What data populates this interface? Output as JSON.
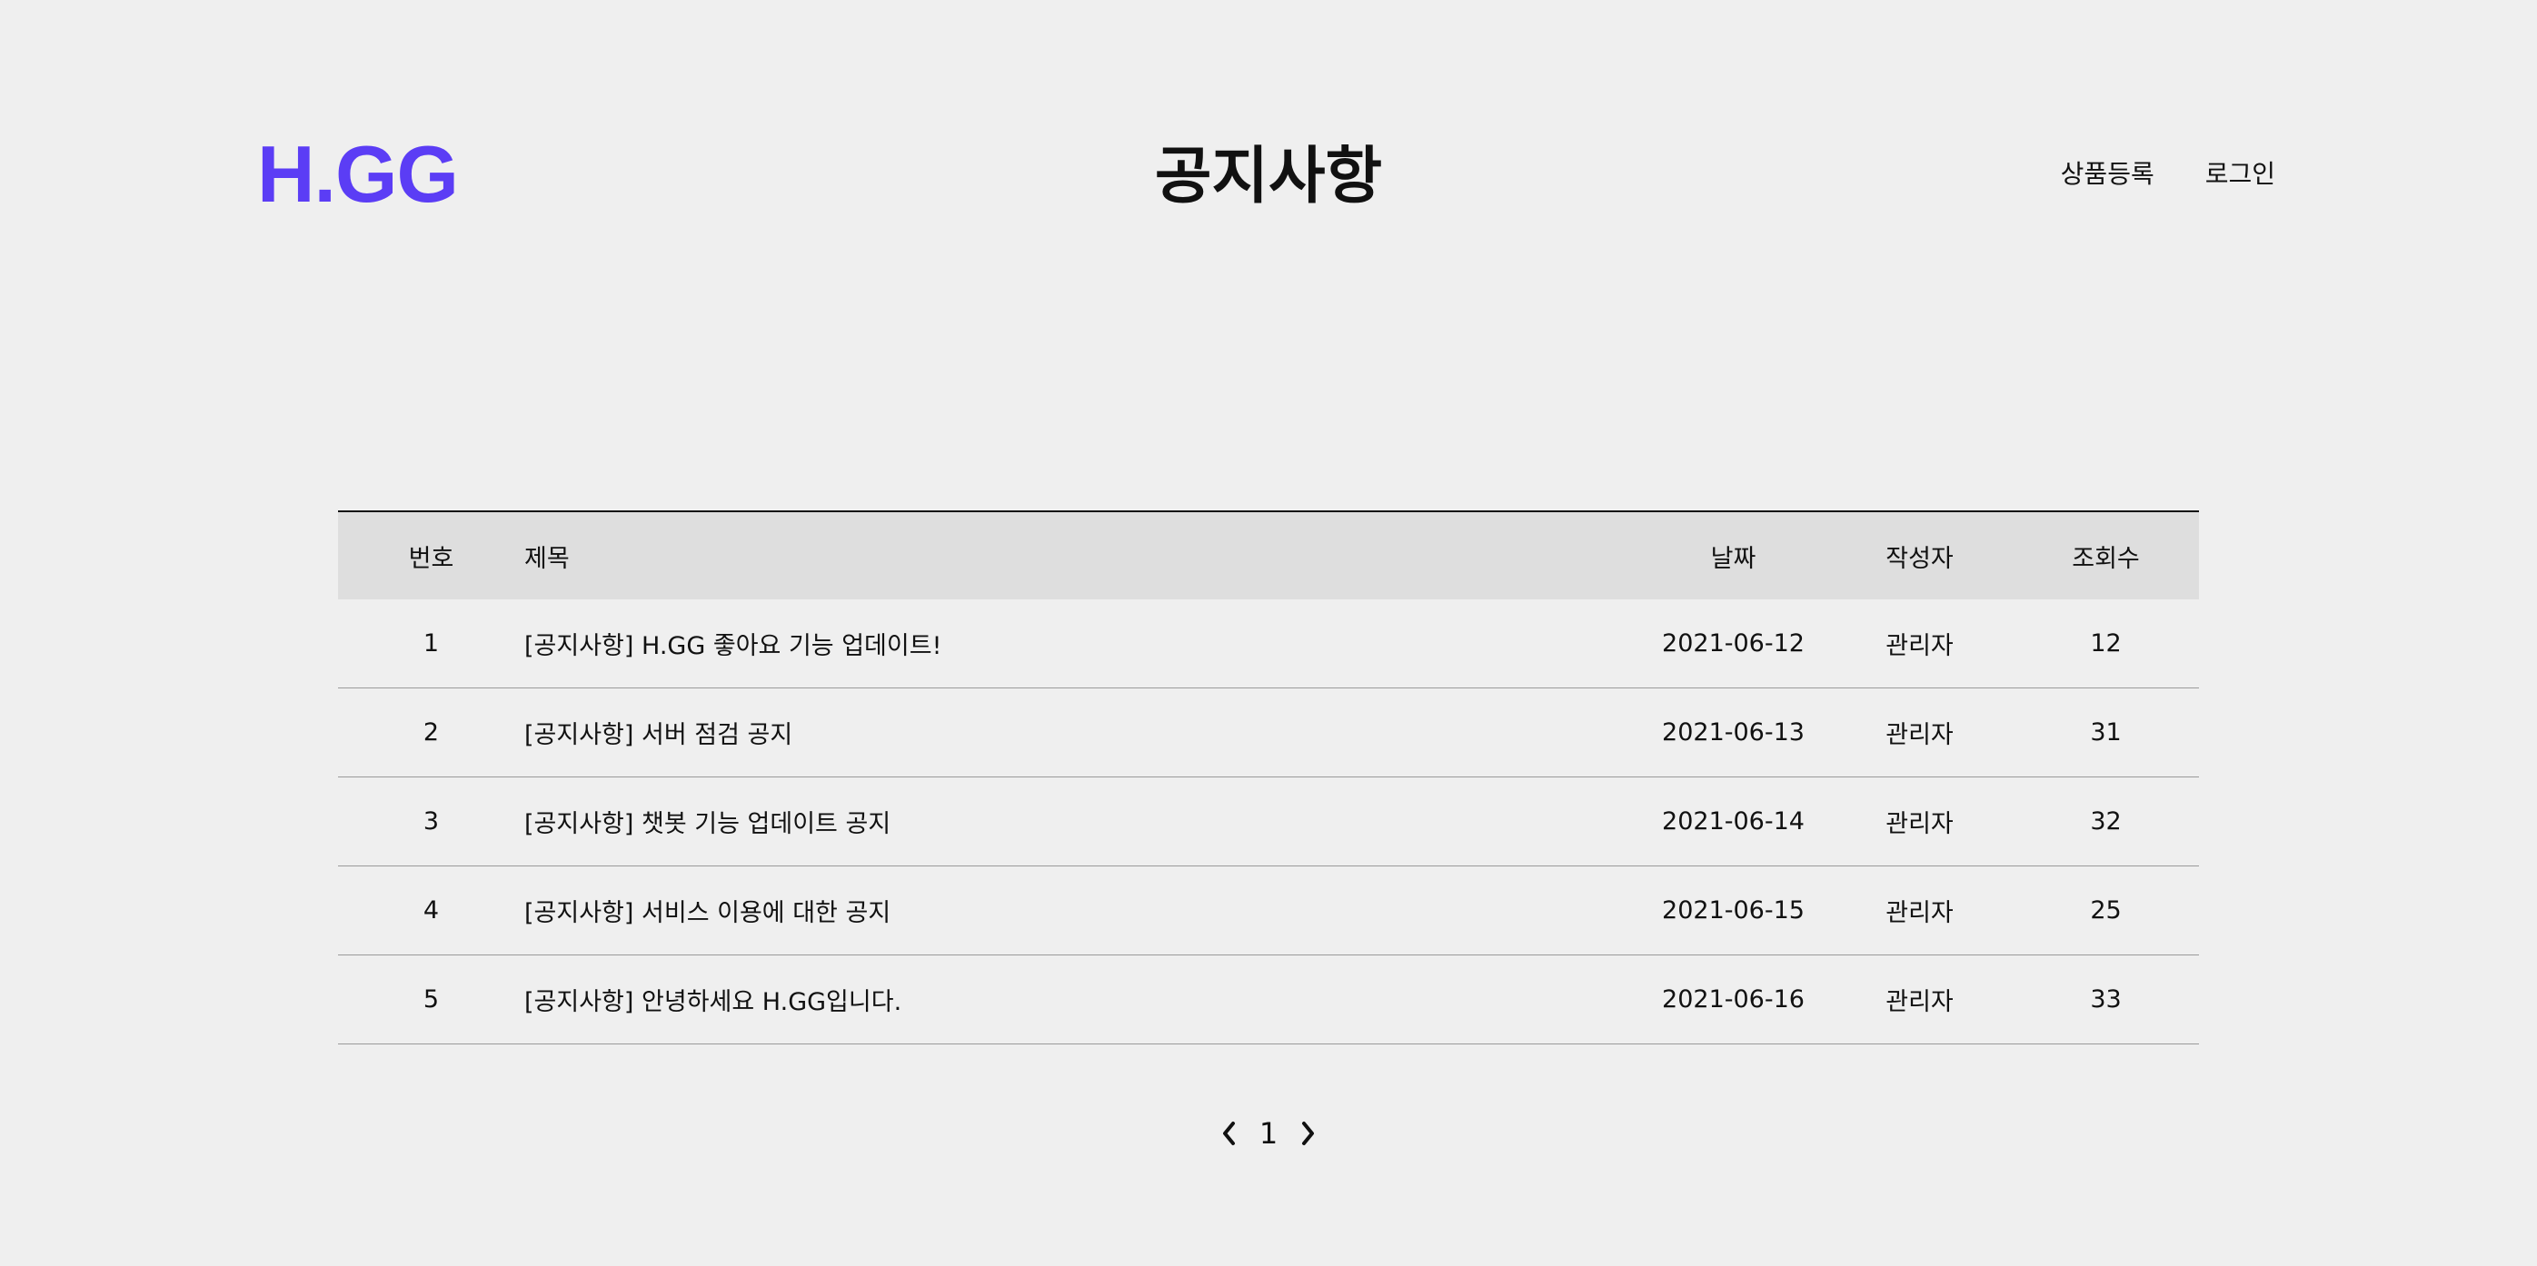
{
  "header": {
    "logo": "H.GG",
    "title": "공지사항",
    "nav": [
      "상품등록",
      "로그인"
    ]
  },
  "table": {
    "columns": [
      "번호",
      "제목",
      "날짜",
      "작성자",
      "조회수"
    ],
    "rows": [
      {
        "num": "1",
        "title": "[공지사항] H.GG 좋아요 기능 업데이트!",
        "date": "2021-06-12",
        "author": "관리자",
        "views": "12"
      },
      {
        "num": "2",
        "title": "[공지사항] 서버 점검 공지",
        "date": "2021-06-13",
        "author": "관리자",
        "views": "31"
      },
      {
        "num": "3",
        "title": "[공지사항] 챗봇 기능 업데이트 공지",
        "date": "2021-06-14",
        "author": "관리자",
        "views": "32"
      },
      {
        "num": "4",
        "title": "[공지사항] 서비스 이용에 대한 공지",
        "date": "2021-06-15",
        "author": "관리자",
        "views": "25"
      },
      {
        "num": "5",
        "title": "[공지사항] 안녕하세요 H.GG입니다.",
        "date": "2021-06-16",
        "author": "관리자",
        "views": "33"
      }
    ]
  },
  "pagination": {
    "current_page": "1",
    "prev_icon": "chevron-left-icon",
    "next_icon": "chevron-right-icon"
  },
  "colors": {
    "accent": "#5b3df5",
    "background": "#efefef",
    "header_row": "#dedede"
  }
}
